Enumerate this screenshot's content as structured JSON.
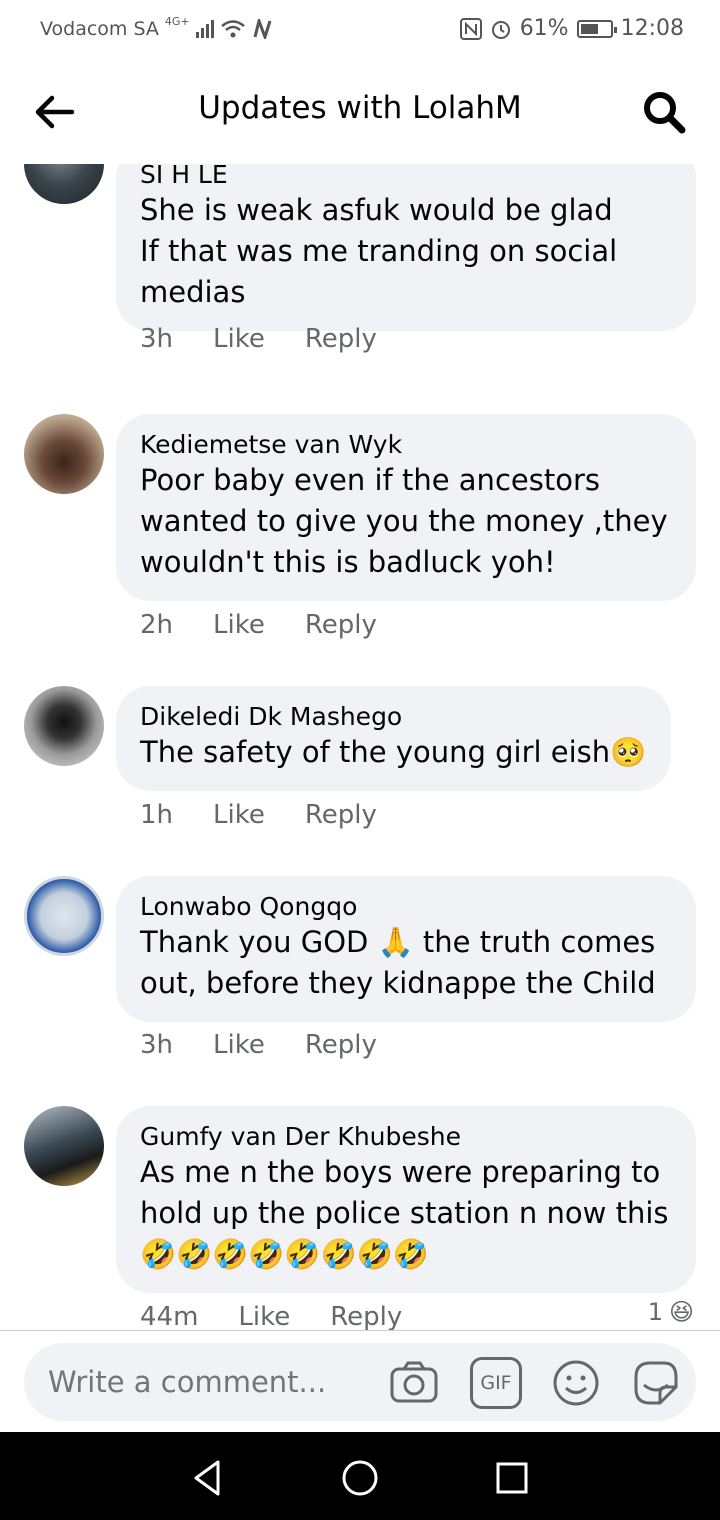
{
  "status_bar": {
    "carrier": "Vodacom SA",
    "network": "4G+",
    "battery": "61%",
    "battery_level": 0.61,
    "time": "12:08",
    "icons": [
      "signal-icon",
      "wifi-icon",
      "nfc-icon",
      "alarm-icon",
      "battery-icon"
    ]
  },
  "header": {
    "title": "Updates with LolahM",
    "back_icon": "arrow-left-icon",
    "search_icon": "search-icon"
  },
  "comments": [
    {
      "name": "SI H LE",
      "lines": [
        "She is weak asfuk  would be glad",
        "If that was me tranding on social",
        "medias"
      ],
      "time": "3h",
      "like": "Like",
      "reply": "Reply",
      "avatar_colors": [
        "#1e2a30",
        "#5d6b73"
      ]
    },
    {
      "name": "Kediemetse van Wyk",
      "lines": [
        "Poor baby even if the ancestors",
        "wanted to give you the money ,they",
        "wouldn't this is badluck yoh!"
      ],
      "time": "2h",
      "like": "Like",
      "reply": "Reply",
      "avatar_colors": [
        "#6b4a3a",
        "#b9a38a"
      ]
    },
    {
      "name": "Dikeledi Dk Mashego",
      "lines": [
        "The safety of the young girl eish🥺"
      ],
      "time": "1h",
      "like": "Like",
      "reply": "Reply",
      "avatar_colors": [
        "#d9d9d9",
        "#222222"
      ]
    },
    {
      "name": "Lonwabo Qongqo",
      "lines": [
        "Thank you GOD 🙏 the truth comes",
        "out, before they kidnappe the Child"
      ],
      "time": "3h",
      "like": "Like",
      "reply": "Reply",
      "avatar_colors": [
        "#dfe6ee",
        "#2b5aa8"
      ]
    },
    {
      "name": "Gumfy van Der Khubeshe",
      "lines": [
        "As me n the boys were preparing to",
        "hold up the police station n now this",
        "🤣🤣🤣🤣🤣🤣🤣🤣"
      ],
      "time": "44m",
      "like": "Like",
      "reply": "Reply",
      "reaction_count": "1",
      "reaction_emoji": "😆",
      "avatar_colors": [
        "#3b4a55",
        "#c9a24a"
      ]
    }
  ],
  "composer": {
    "placeholder": "Write a comment...",
    "icons": [
      "camera-icon",
      "gif-icon",
      "emoji-icon",
      "sticker-icon"
    ],
    "gif_label": "GIF"
  },
  "nav_bar": {
    "icons": [
      "back-triangle-icon",
      "home-circle-icon",
      "recents-square-icon"
    ]
  }
}
